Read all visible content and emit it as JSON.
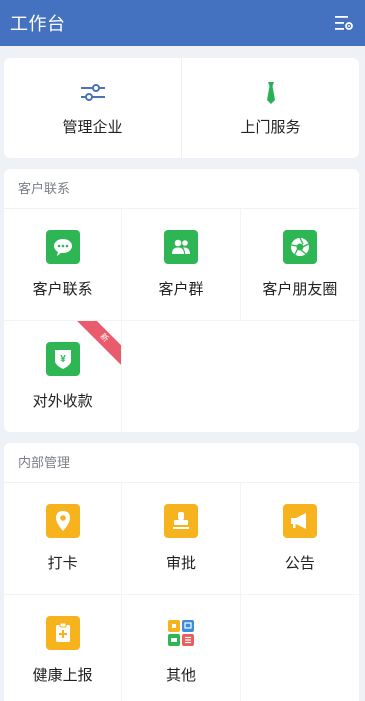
{
  "header": {
    "title": "工作台",
    "settings_icon": "settings-filter-icon"
  },
  "top_actions": [
    {
      "label": "管理企业",
      "icon": "sliders-icon"
    },
    {
      "label": "上门服务",
      "icon": "tie-icon"
    }
  ],
  "customer_section": {
    "title": "客户联系",
    "items": [
      {
        "label": "客户联系",
        "icon": "chat-bubble-icon",
        "color": "#2eb655"
      },
      {
        "label": "客户群",
        "icon": "group-users-icon",
        "color": "#2eb655"
      },
      {
        "label": "客户朋友圈",
        "icon": "aperture-icon",
        "color": "#2eb655"
      },
      {
        "label": "对外收款",
        "icon": "yen-shield-icon",
        "color": "#2eb655",
        "badge": "新"
      }
    ]
  },
  "internal_section": {
    "title": "内部管理",
    "items": [
      {
        "label": "打卡",
        "icon": "location-pin-icon",
        "color": "#f6b31d"
      },
      {
        "label": "审批",
        "icon": "stamp-icon",
        "color": "#f6b31d"
      },
      {
        "label": "公告",
        "icon": "megaphone-icon",
        "color": "#f6b31d"
      },
      {
        "label": "健康上报",
        "icon": "medical-report-icon",
        "color": "#f6b31d"
      },
      {
        "label": "其他",
        "icon": "app-grid-icon",
        "color": "multi"
      }
    ]
  }
}
